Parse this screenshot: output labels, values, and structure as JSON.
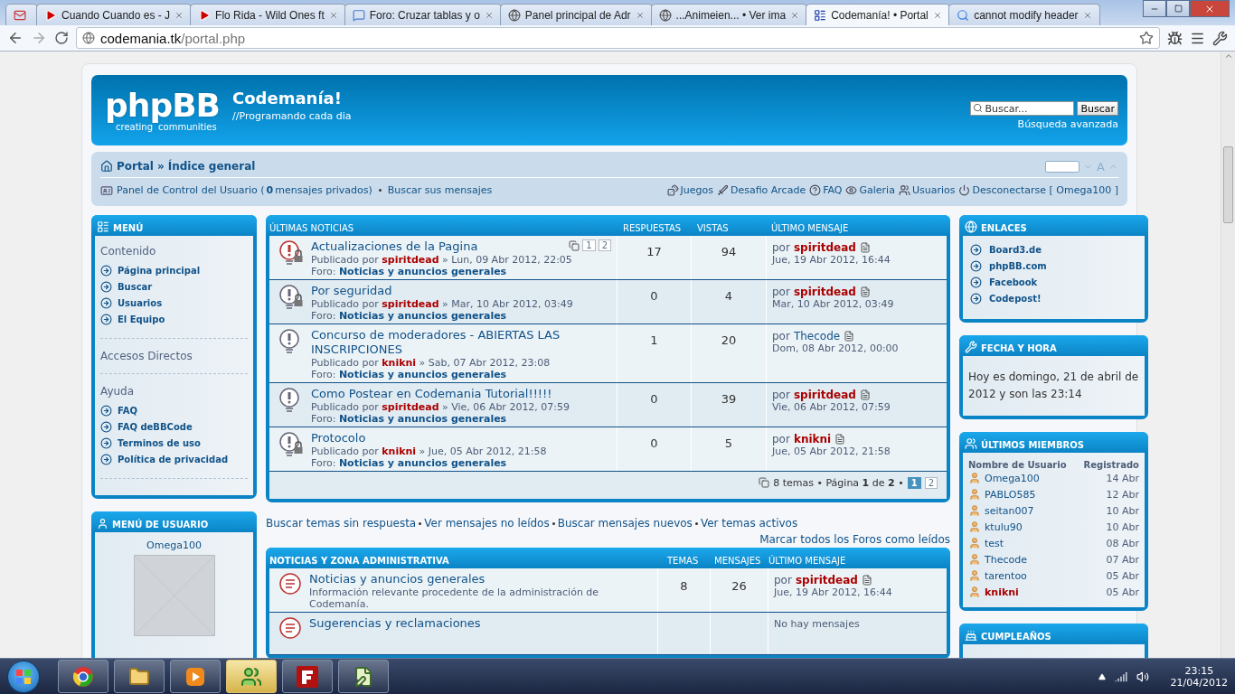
{
  "browser": {
    "tabs": [
      {
        "kind": "mail",
        "selected": false
      },
      {
        "kind": "video",
        "title": "Cuando Cuando es - J",
        "selected": false
      },
      {
        "kind": "video",
        "title": "Flo Rida - Wild Ones ft",
        "selected": false
      },
      {
        "kind": "forum",
        "title": "Foro: Cruzar tablas y o",
        "selected": false
      },
      {
        "kind": "globe",
        "title": "Panel principal de Adr",
        "selected": false
      },
      {
        "kind": "globe",
        "title": "...Animeien... • Ver ima",
        "selected": false
      },
      {
        "kind": "site",
        "title": "Codemanía! • Portal",
        "selected": true
      },
      {
        "kind": "search",
        "title": "cannot modify header",
        "selected": false
      }
    ],
    "url": {
      "host": "codemania.tk",
      "path": "/portal.php"
    }
  },
  "header": {
    "logo": {
      "name": "phpBB",
      "tagline_left": "creating",
      "tagline_right": "communities"
    },
    "site_title": "Codemanía!",
    "site_tagline": "//Programando cada dia",
    "search": {
      "placeholder": "Buscar...",
      "button": "Buscar"
    },
    "advanced_search": "Búsqueda avanzada"
  },
  "navbar": {
    "breadcrumbs": [
      {
        "label": "Portal"
      },
      {
        "label": "Índice general",
        "separator": "»"
      }
    ],
    "font_size_label": "A",
    "user_links": [
      "Panel de Control del Usuario (**0** mensajes privados)",
      "Buscar sus mensajes"
    ],
    "links": [
      {
        "kind": "dice",
        "label": "Juegos"
      },
      {
        "kind": "sword",
        "label": "Desafio Arcade"
      },
      {
        "kind": "help",
        "label": "FAQ"
      },
      {
        "kind": "eye",
        "label": "Galeria"
      },
      {
        "kind": "users",
        "label": "Usuarios"
      },
      {
        "kind": "power",
        "label": "Desconectarse [ Omega100 ]"
      }
    ]
  },
  "menu": {
    "title": "MENÚ",
    "sections": [
      {
        "heading": "Contenido",
        "items": [
          "Página principal",
          "Buscar",
          "Usuarios",
          "El Equipo"
        ]
      },
      {
        "heading": "Accesos Directos"
      },
      {
        "heading": "Ayuda",
        "items": [
          "FAQ",
          "FAQ deBBCode",
          "Terminos de uso",
          "Política de privacidad"
        ]
      }
    ]
  },
  "user_menu": {
    "title": "MENÚ DE USUARIO",
    "username": "Omega100"
  },
  "news": {
    "columns": [
      "ÚLTIMAS NOTICIAS",
      "RESPUESTAS",
      "VISTAS",
      "ÚLTIMO MENSAJE"
    ],
    "rows": [
      {
        "title": "Actualizaciones de la Pagina",
        "pages": [
          "1",
          "2"
        ],
        "hot": true,
        "locked": true,
        "posted_label": "Publicado por",
        "author": "spiritdead",
        "author_highlight": true,
        "date": "» Lun, 09 Abr 2012, 22:05",
        "forum_label": "Foro:",
        "forum": "Noticias y anuncios generales",
        "replies": "17",
        "views": "94",
        "last_label": "por",
        "last_author": "spiritdead",
        "last_highlight": true,
        "last_date": "Jue, 19 Abr 2012, 16:44"
      },
      {
        "title": "Por seguridad",
        "hot": false,
        "locked": true,
        "posted_label": "Publicado por",
        "author": "spiritdead",
        "author_highlight": true,
        "date": "» Mar, 10 Abr 2012, 03:49",
        "forum_label": "Foro:",
        "forum": "Noticias y anuncios generales",
        "replies": "0",
        "views": "4",
        "last_label": "por",
        "last_author": "spiritdead",
        "last_highlight": true,
        "last_date": "Mar, 10 Abr 2012, 03:49"
      },
      {
        "title": "Concurso de moderadores - ABIERTAS LAS INSCRIPCIONES",
        "hot": false,
        "locked": false,
        "posted_label": "Publicado por",
        "author": "knikni",
        "author_highlight": true,
        "date": "» Sab, 07 Abr 2012, 23:08",
        "forum_label": "Foro:",
        "forum": "Noticias y anuncios generales",
        "replies": "1",
        "views": "20",
        "last_label": "por",
        "last_author": "Thecode",
        "last_highlight": false,
        "last_date": "Dom, 08 Abr 2012, 00:00"
      },
      {
        "title": "Como Postear en Codemania Tutorial!!!!!",
        "hot": false,
        "locked": false,
        "posted_label": "Publicado por",
        "author": "spiritdead",
        "author_highlight": true,
        "date": "» Vie, 06 Abr 2012, 07:59",
        "forum_label": "Foro:",
        "forum": "Noticias y anuncios generales",
        "replies": "0",
        "views": "39",
        "last_label": "por",
        "last_author": "spiritdead",
        "last_highlight": true,
        "last_date": "Vie, 06 Abr 2012, 07:59"
      },
      {
        "title": "Protocolo",
        "hot": false,
        "locked": true,
        "posted_label": "Publicado por",
        "author": "knikni",
        "author_highlight": true,
        "date": "» Jue, 05 Abr 2012, 21:58",
        "forum_label": "Foro:",
        "forum": "Noticias y anuncios generales",
        "replies": "0",
        "views": "5",
        "last_label": "por",
        "last_author": "knikni",
        "last_highlight": true,
        "last_date": "Jue, 05 Abr 2012, 21:58"
      }
    ],
    "pagination": {
      "summary": "8 temas • Página **1** de **2** •",
      "pages": [
        {
          "label": "1",
          "selected": true
        },
        {
          "label": "2",
          "selected": false
        }
      ]
    }
  },
  "quick_links": [
    "Buscar temas sin respuesta",
    "Ver mensajes no leídos",
    "Buscar mensajes nuevos",
    "Ver temas activos"
  ],
  "mark_read": "Marcar todos los Foros como leídos",
  "forums": {
    "columns": [
      "NOTICIAS Y ZONA ADMINISTRATIVA",
      "TEMAS",
      "MENSAJES",
      "ÚLTIMO MENSAJE"
    ],
    "rows": [
      {
        "name": "Noticias y anuncios generales",
        "description": "Información relevante procedente de la administración de Codemanía.",
        "topics": "8",
        "posts": "26",
        "last_label": "por",
        "last_author": "spiritdead",
        "last_highlight": true,
        "last_date": "Jue, 19 Abr 2012, 16:44"
      },
      {
        "name": "Sugerencias y reclamaciones",
        "last_text": "No hay mensajes"
      }
    ]
  },
  "links_box": {
    "title": "ENLACES",
    "items": [
      "Board3.de",
      "phpBB.com",
      "Facebook",
      "Codepost!"
    ]
  },
  "date_box": {
    "title": "FECHA Y HORA",
    "text": "Hoy es domingo, 21 de abril de 2012 y son las 23:14"
  },
  "members": {
    "title": "ÚLTIMOS MIEMBROS",
    "columns": [
      "Nombre de Usuario",
      "Registrado"
    ],
    "rows": [
      {
        "name": "Omega100",
        "date": "14 Abr",
        "highlight": false
      },
      {
        "name": "PABLO585",
        "date": "12 Abr",
        "highlight": false
      },
      {
        "name": "seitan007",
        "date": "10 Abr",
        "highlight": false
      },
      {
        "name": "ktulu90",
        "date": "10 Abr",
        "highlight": false
      },
      {
        "name": "test",
        "date": "08 Abr",
        "highlight": false
      },
      {
        "name": "Thecode",
        "date": "07 Abr",
        "highlight": false
      },
      {
        "name": "tarentoo",
        "date": "05 Abr",
        "highlight": false
      },
      {
        "name": "knikni",
        "date": "05 Abr",
        "highlight": true
      }
    ]
  },
  "birthdays": {
    "title": "CUMPLEAÑOS"
  },
  "taskbar": {
    "apps": [
      {
        "kind": "browser",
        "selected": false
      },
      {
        "kind": "folder",
        "selected": false
      },
      {
        "kind": "media",
        "selected": false
      },
      {
        "kind": "messenger",
        "selected": true
      },
      {
        "kind": "ftp",
        "selected": false
      },
      {
        "kind": "editor",
        "selected": false
      }
    ],
    "time": "23:15",
    "date": "21/04/2012"
  }
}
